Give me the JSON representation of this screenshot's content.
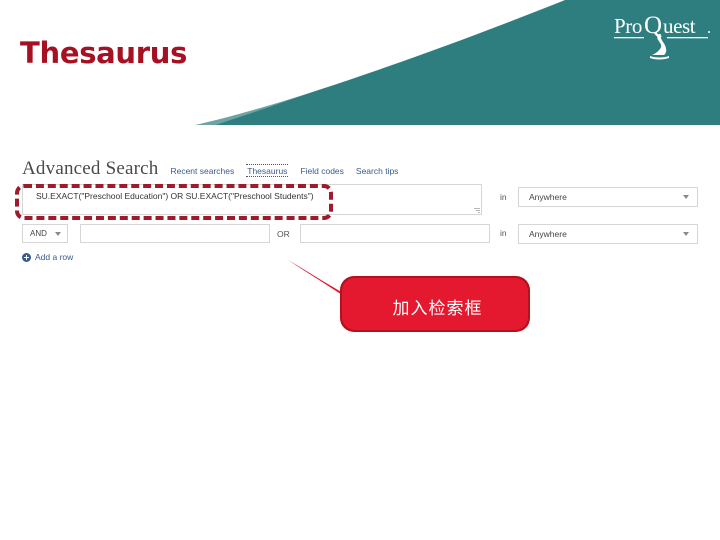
{
  "slide": {
    "title": "Thesaurus",
    "title_color": "#A51022",
    "brand": {
      "name": "ProQuest",
      "teal": "#2E7E80",
      "teal_light": "#6FA3A2"
    }
  },
  "screenshot": {
    "heading": "Advanced Search",
    "nav_links": [
      {
        "label": "Recent searches",
        "focused": false
      },
      {
        "label": "Thesaurus",
        "focused": true
      },
      {
        "label": "Field codes",
        "focused": false
      },
      {
        "label": "Search tips",
        "focused": false
      }
    ],
    "row1": {
      "query_value": "SU.EXACT(\"Preschool Education\") OR SU.EXACT(\"Preschool Students\")",
      "query_placeholder": "",
      "in_label": "in",
      "field_select_value": "Anywhere"
    },
    "row2": {
      "operator_value": "AND",
      "term_a_value": "",
      "term_a_placeholder": "",
      "or_label": "OR",
      "term_b_value": "",
      "term_b_placeholder": "",
      "in_label": "in",
      "field_select_value": "Anywhere"
    },
    "add_row_label": "Add a row"
  },
  "annotation": {
    "callout_text": "加入检索框",
    "callout_color": "#E4182F",
    "callout_border_color": "#B3121F",
    "highlight_color": "#9E1B2B"
  }
}
